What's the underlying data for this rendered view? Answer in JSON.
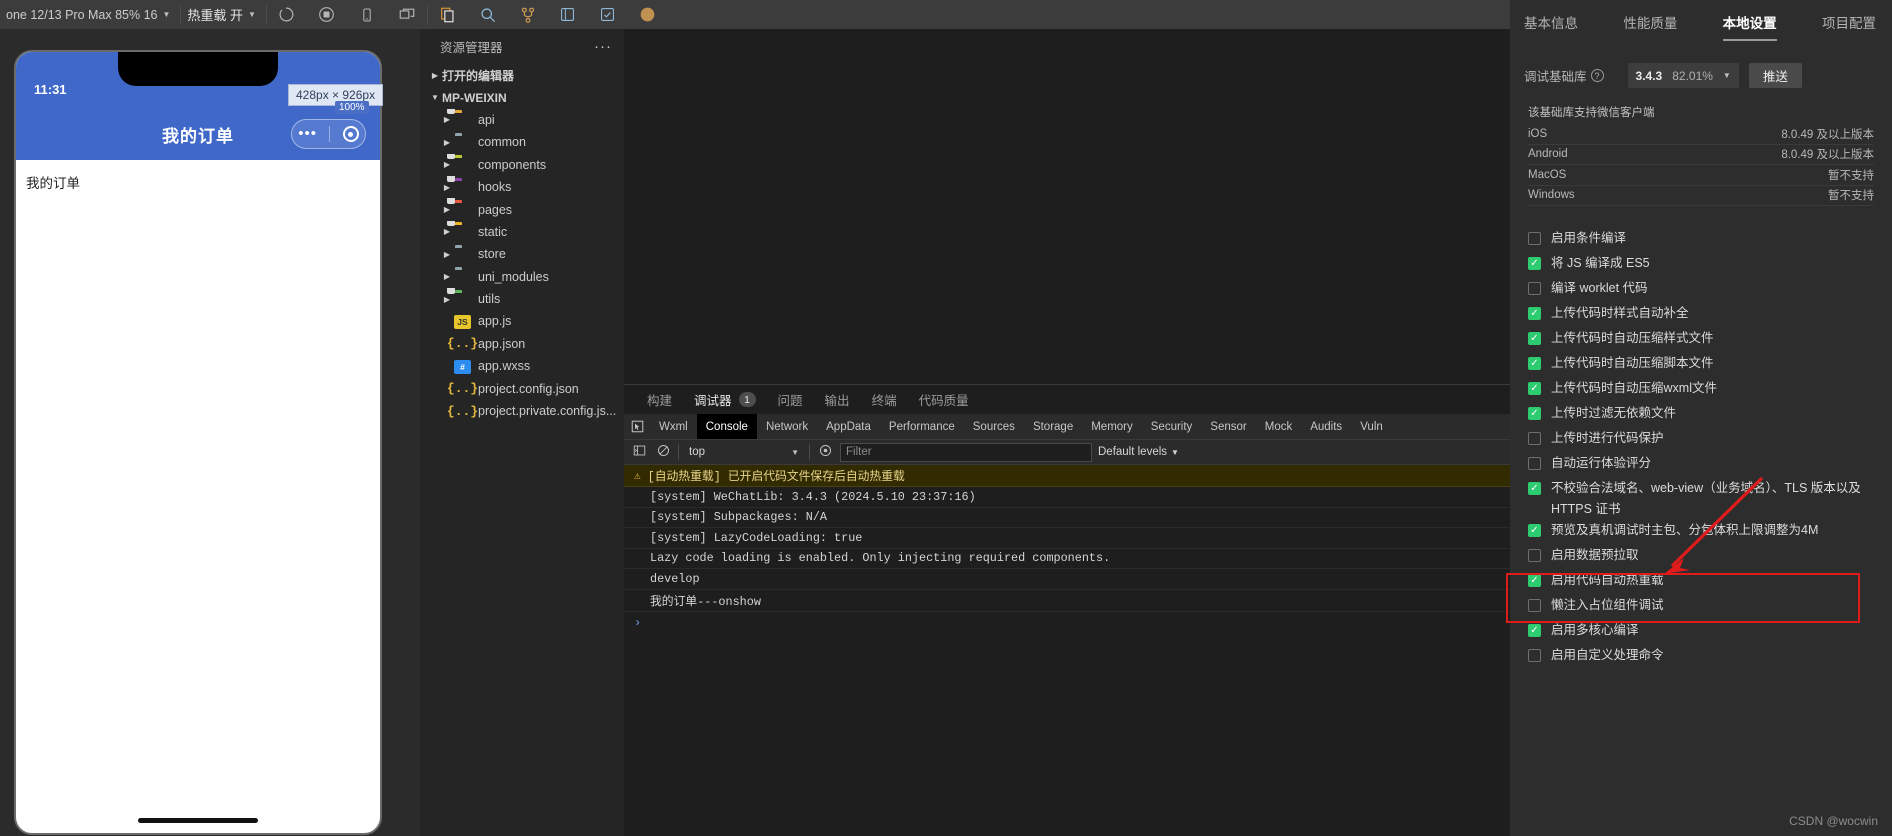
{
  "toolbar": {
    "device_selector": "one 12/13 Pro Max 85% 16",
    "hot_reload": "热重载 开",
    "icons": [
      {
        "name": "refresh-icon"
      },
      {
        "name": "stop-record-icon"
      },
      {
        "name": "phone-icon"
      },
      {
        "name": "multi-window-icon"
      },
      {
        "name": "copy-files-icon"
      },
      {
        "name": "search-icon"
      },
      {
        "name": "source-control-icon"
      },
      {
        "name": "extensions-icon"
      },
      {
        "name": "test-icon"
      },
      {
        "name": "cloud-icon"
      }
    ]
  },
  "simulator": {
    "time": "11:31",
    "nav_title": "我的订单",
    "page_text": "我的订单",
    "size_badge": "428px × 926px",
    "zoom_badge": "100%"
  },
  "explorer": {
    "title": "资源管理器",
    "more_label": "···",
    "open_editors": "打开的编辑器",
    "project": "MP-WEIXIN",
    "items": [
      {
        "label": "api",
        "type": "folder",
        "color": "#e8a838",
        "badge": true
      },
      {
        "label": "common",
        "type": "folder",
        "color": "#90a4ae",
        "badge": false
      },
      {
        "label": "components",
        "type": "folder",
        "color": "#c0ca33",
        "badge": true
      },
      {
        "label": "hooks",
        "type": "folder",
        "color": "#8e44ad",
        "badge": true
      },
      {
        "label": "pages",
        "type": "folder",
        "color": "#e8573f",
        "badge": true
      },
      {
        "label": "static",
        "type": "folder",
        "color": "#f0b429",
        "badge": true
      },
      {
        "label": "store",
        "type": "folder",
        "color": "#90a4ae",
        "badge": false
      },
      {
        "label": "uni_modules",
        "type": "folder",
        "color": "#90a4ae",
        "badge": false
      },
      {
        "label": "utils",
        "type": "folder",
        "color": "#5cb85c",
        "badge": true
      }
    ],
    "files": [
      {
        "label": "app.js",
        "icon": "JS",
        "icon_bg": "#e8c52a",
        "icon_fg": "#333333"
      },
      {
        "label": "app.json",
        "icon": "{..}",
        "icon_bg": "transparent",
        "icon_fg": "#e8b93a"
      },
      {
        "label": "app.wxss",
        "icon": "#",
        "icon_bg": "#2d8cf0",
        "icon_fg": "#ffffff"
      },
      {
        "label": "project.config.json",
        "icon": "{..}",
        "icon_bg": "transparent",
        "icon_fg": "#e8b93a"
      },
      {
        "label": "project.private.config.js...",
        "icon": "{..}",
        "icon_bg": "transparent",
        "icon_fg": "#e8b93a"
      }
    ]
  },
  "panel": {
    "tabs": [
      {
        "label": "构建",
        "active": false,
        "count": null
      },
      {
        "label": "调试器",
        "active": true,
        "count": "1"
      },
      {
        "label": "问题",
        "active": false,
        "count": null
      },
      {
        "label": "输出",
        "active": false,
        "count": null
      },
      {
        "label": "终端",
        "active": false,
        "count": null
      },
      {
        "label": "代码质量",
        "active": false,
        "count": null
      }
    ],
    "devtools_tabs": [
      {
        "label": "Wxml",
        "active": false
      },
      {
        "label": "Console",
        "active": true
      },
      {
        "label": "Network",
        "active": false
      },
      {
        "label": "AppData",
        "active": false
      },
      {
        "label": "Performance",
        "active": false
      },
      {
        "label": "Sources",
        "active": false
      },
      {
        "label": "Storage",
        "active": false
      },
      {
        "label": "Memory",
        "active": false
      },
      {
        "label": "Security",
        "active": false
      },
      {
        "label": "Sensor",
        "active": false
      },
      {
        "label": "Mock",
        "active": false
      },
      {
        "label": "Audits",
        "active": false
      },
      {
        "label": "Vuln",
        "active": false
      }
    ],
    "console_bar": {
      "context": "top",
      "filter_placeholder": "Filter",
      "levels": "Default levels"
    },
    "console_rows": [
      {
        "text": "[自动热重载] 已开启代码文件保存后自动热重载",
        "level": "warn"
      },
      {
        "text": "[system] WeChatLib: 3.4.3 (2024.5.10 23:37:16)",
        "level": "log"
      },
      {
        "text": "[system] Subpackages: N/A",
        "level": "log"
      },
      {
        "text": "[system] LazyCodeLoading: true",
        "level": "log"
      },
      {
        "text": "Lazy code loading is enabled. Only injecting required components.",
        "level": "log"
      },
      {
        "text": "develop",
        "level": "log"
      },
      {
        "text": "我的订单---onshow",
        "level": "log"
      }
    ],
    "prompt": "›"
  },
  "settings": {
    "tabs": [
      {
        "label": "基本信息",
        "active": false
      },
      {
        "label": "性能质量",
        "active": false
      },
      {
        "label": "本地设置",
        "active": true
      },
      {
        "label": "项目配置",
        "active": false
      }
    ],
    "lib": {
      "label": "调试基础库",
      "version": "3.4.3",
      "percent": "82.01%",
      "push_button": "推送"
    },
    "support": {
      "title": "该基础库支持微信客户端",
      "rows": [
        {
          "platform": "iOS",
          "value": "8.0.49 及以上版本"
        },
        {
          "platform": "Android",
          "value": "8.0.49 及以上版本"
        },
        {
          "platform": "MacOS",
          "value": "暂不支持"
        },
        {
          "platform": "Windows",
          "value": "暂不支持"
        }
      ]
    },
    "options": [
      {
        "label": "启用条件编译",
        "checked": false
      },
      {
        "label": "将 JS 编译成 ES5",
        "checked": true
      },
      {
        "label": "编译 worklet 代码",
        "checked": false
      },
      {
        "label": "上传代码时样式自动补全",
        "checked": true
      },
      {
        "label": "上传代码时自动压缩样式文件",
        "checked": true
      },
      {
        "label": "上传代码时自动压缩脚本文件",
        "checked": true
      },
      {
        "label": "上传代码时自动压缩wxml文件",
        "checked": true
      },
      {
        "label": "上传时过滤无依赖文件",
        "checked": true
      },
      {
        "label": "上传时进行代码保护",
        "checked": false
      },
      {
        "label": "自动运行体验评分",
        "checked": false
      },
      {
        "label": "不校验合法域名、web-view（业务域名）、TLS 版本以及 HTTPS 证书",
        "checked": true,
        "highlighted": true
      },
      {
        "label": "预览及真机调试时主包、分包体积上限调整为4M",
        "checked": true
      },
      {
        "label": "启用数据预拉取",
        "checked": false
      },
      {
        "label": "启用代码自动热重载",
        "checked": true
      },
      {
        "label": "懒注入占位组件调试",
        "checked": false
      },
      {
        "label": "启用多核心编译",
        "checked": true
      },
      {
        "label": "启用自定义处理命令",
        "checked": false
      }
    ]
  },
  "watermark": "CSDN @wocwin",
  "colors": {
    "accent_green": "#2ecc71",
    "highlight_red": "#e01b1b",
    "phone_blue": "#3f68c9"
  }
}
